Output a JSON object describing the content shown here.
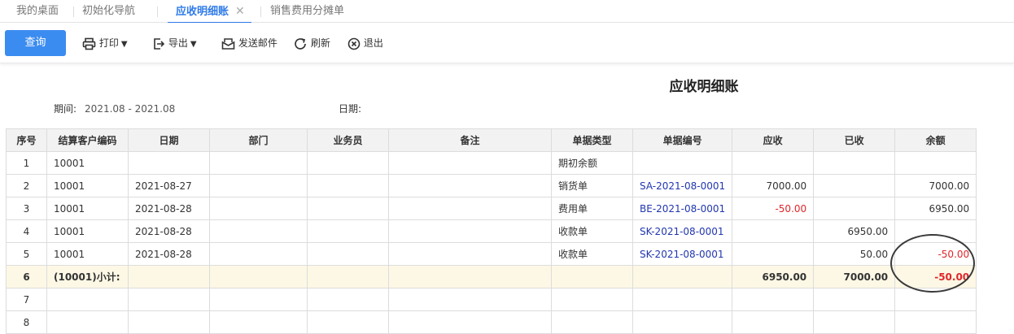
{
  "tabs": [
    {
      "label": "我的桌面"
    },
    {
      "label": "初始化导航"
    },
    {
      "label": "应收明细账",
      "close": "✕"
    },
    {
      "label": "销售费用分摊单"
    }
  ],
  "toolbar": {
    "query": "查询",
    "print": "打印",
    "export": "导出",
    "send_mail": "发送邮件",
    "refresh": "刷新",
    "exit": "退出"
  },
  "report": {
    "title": "应收明细账",
    "period_label": "期间:",
    "period_value": "2021.08 - 2021.08",
    "date_label": "日期:"
  },
  "table": {
    "columns": [
      "序号",
      "结算客户编码",
      "日期",
      "部门",
      "业务员",
      "备注",
      "单据类型",
      "单据编号",
      "应收",
      "已收",
      "余额"
    ],
    "rows": [
      {
        "seq": "1",
        "customer": "10001",
        "date": "",
        "dept": "",
        "staff": "",
        "note": "",
        "type": "期初余额",
        "doc": "",
        "receivable": "",
        "received": "",
        "balance": ""
      },
      {
        "seq": "2",
        "customer": "10001",
        "date": "2021-08-27",
        "dept": "",
        "staff": "",
        "note": "",
        "type": "销货单",
        "doc": "SA-2021-08-0001",
        "receivable": "7000.00",
        "received": "",
        "balance": "7000.00"
      },
      {
        "seq": "3",
        "customer": "10001",
        "date": "2021-08-28",
        "dept": "",
        "staff": "",
        "note": "",
        "type": "费用单",
        "doc": "BE-2021-08-0001",
        "receivable": "-50.00",
        "received": "",
        "balance": "6950.00"
      },
      {
        "seq": "4",
        "customer": "10001",
        "date": "2021-08-28",
        "dept": "",
        "staff": "",
        "note": "",
        "type": "收款单",
        "doc": "SK-2021-08-0001",
        "receivable": "",
        "received": "6950.00",
        "balance": ""
      },
      {
        "seq": "5",
        "customer": "10001",
        "date": "2021-08-28",
        "dept": "",
        "staff": "",
        "note": "",
        "type": "收款单",
        "doc": "SK-2021-08-0001",
        "receivable": "",
        "received": "50.00",
        "balance": "-50.00"
      },
      {
        "seq": "6",
        "customer": "(10001)小计:",
        "date": "",
        "dept": "",
        "staff": "",
        "note": "",
        "type": "",
        "doc": "",
        "receivable": "6950.00",
        "received": "7000.00",
        "balance": "-50.00"
      },
      {
        "seq": "7",
        "customer": "",
        "date": "",
        "dept": "",
        "staff": "",
        "note": "",
        "type": "",
        "doc": "",
        "receivable": "",
        "received": "",
        "balance": ""
      },
      {
        "seq": "8",
        "customer": "",
        "date": "",
        "dept": "",
        "staff": "",
        "note": "",
        "type": "",
        "doc": "",
        "receivable": "",
        "received": "",
        "balance": ""
      }
    ]
  },
  "colors": {
    "accent": "#2f7be8",
    "query_button": "#3b8cf0",
    "link": "#2136b0",
    "negative": "#e0262b",
    "subtotal_bg": "#fdf8e5",
    "header_bg": "#f2f2f2"
  },
  "icons": [
    "printer-icon",
    "export-icon",
    "mail-icon",
    "refresh-icon",
    "exit-icon",
    "chevron-down-icon",
    "close-icon"
  ]
}
